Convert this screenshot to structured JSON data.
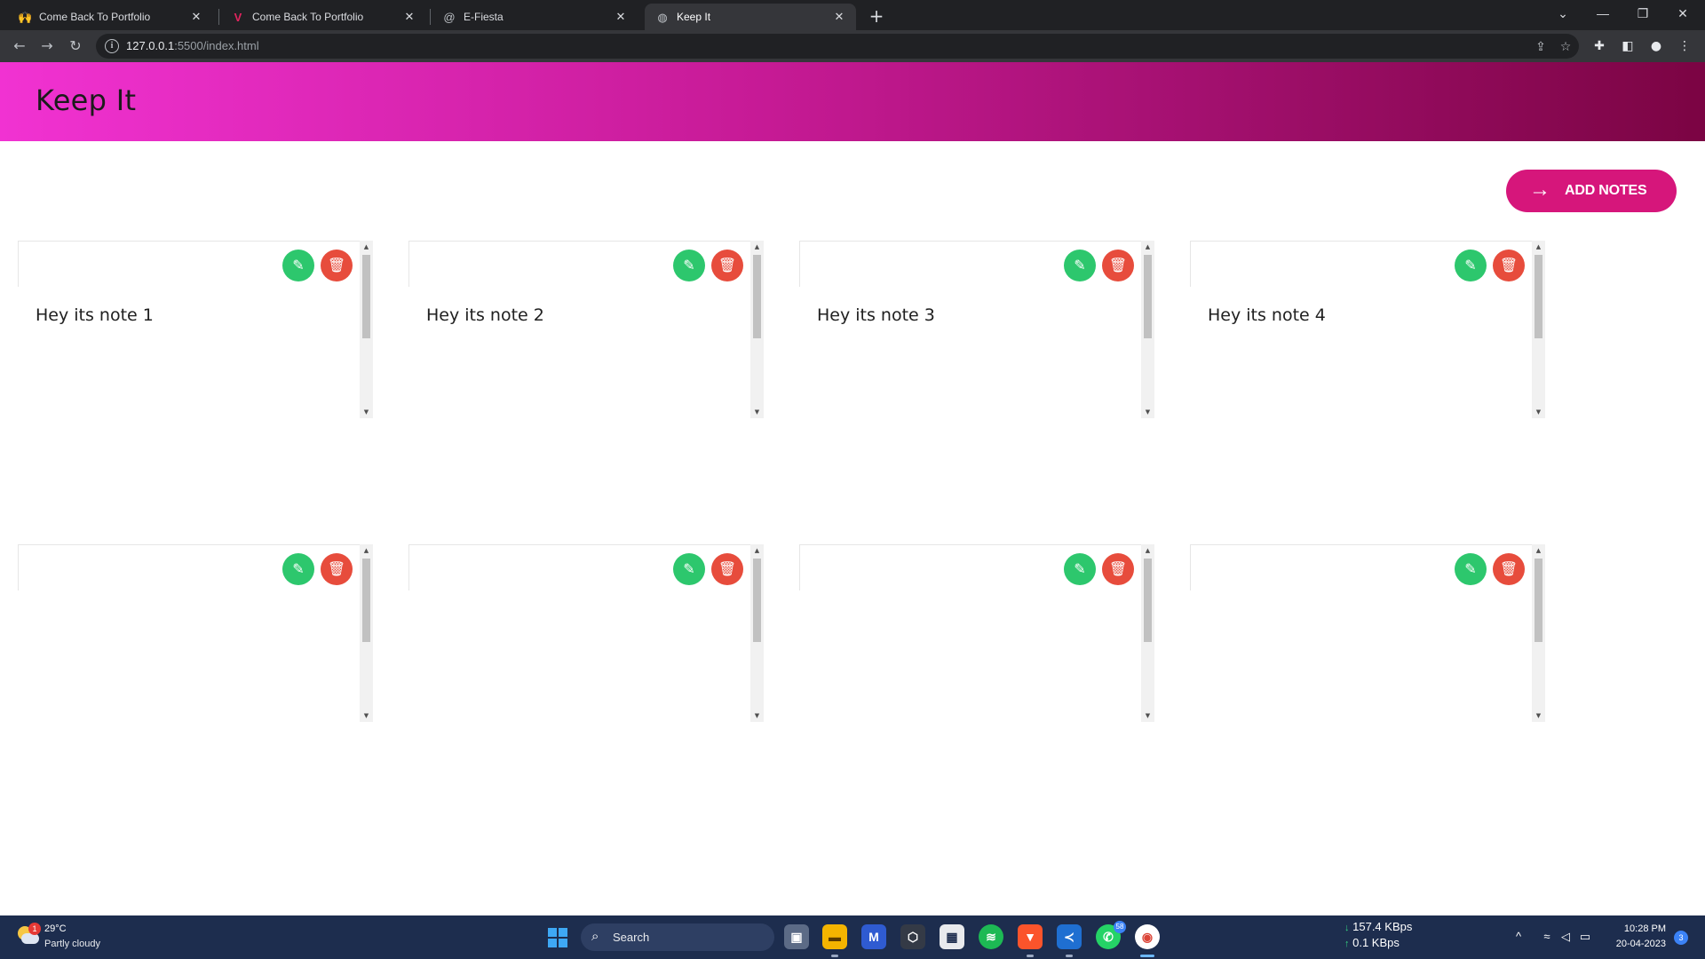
{
  "browser": {
    "tabs": [
      {
        "title": "Come Back To Portfolio",
        "favicon": "hands-emoji-icon"
      },
      {
        "title": "Come Back To Portfolio",
        "favicon": "v-logo-icon"
      },
      {
        "title": "E-Fiesta",
        "favicon": "at-globe-icon"
      },
      {
        "title": "Keep It",
        "favicon": "globe-icon"
      }
    ],
    "close_glyph": "✕",
    "new_tab_glyph": "+",
    "url_host": "127.0.0.1",
    "url_rest": ":5500/index.html"
  },
  "app": {
    "title": "Keep It",
    "add_button_label": "ADD NOTES",
    "notes": [
      {
        "text": "Hey its note 1"
      },
      {
        "text": "Hey its note 2"
      },
      {
        "text": "Hey its note 3"
      },
      {
        "text": "Hey its note 4"
      },
      {
        "text": ""
      },
      {
        "text": ""
      },
      {
        "text": ""
      },
      {
        "text": ""
      }
    ],
    "colors": {
      "header_gradient_start": "#f132d2",
      "header_gradient_end": "#7b0443",
      "add_button": "#d6167b",
      "edit_button": "#2dc76d",
      "delete_button": "#e74c3c"
    }
  },
  "taskbar": {
    "weather_temp": "29°C",
    "weather_desc": "Partly cloudy",
    "weather_badge": "1",
    "search_label": "Search",
    "whatsapp_badge": "58",
    "net_down": "157.4 KBps",
    "net_up": "0.1 KBps",
    "time": "10:28 PM",
    "date": "20-04-2023",
    "notification_count": "3"
  }
}
